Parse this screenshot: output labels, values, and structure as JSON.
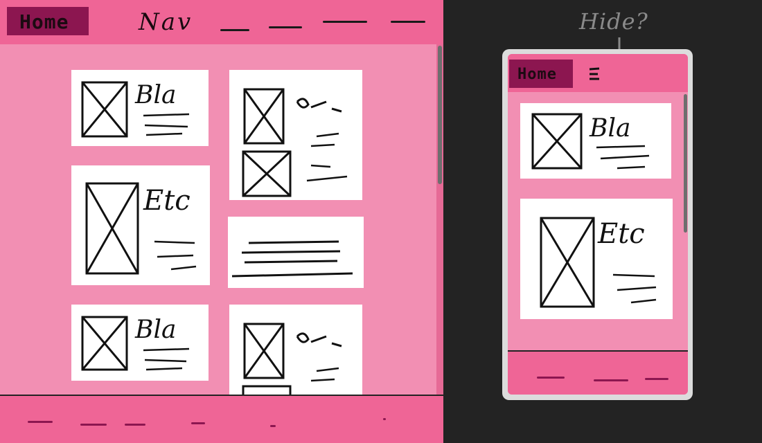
{
  "desktop": {
    "nav": {
      "home_label": "Home",
      "nav_label": "Nav"
    },
    "cards": [
      {
        "heading": "Bla"
      },
      {
        "heading": "Etc"
      },
      {
        "heading": "Bla"
      },
      {
        "heading": ""
      },
      {
        "heading": ""
      }
    ]
  },
  "mobile": {
    "nav": {
      "home_label": "Home",
      "menu_icon": "hamburger-menu-icon"
    },
    "cards": [
      {
        "heading": "Bla"
      },
      {
        "heading": "Etc"
      }
    ]
  },
  "annotation": {
    "hide_note": "Hide?"
  },
  "colors": {
    "nav_bar": "#ef6596",
    "page_bg": "#f28fb3",
    "home_badge": "#8c1650",
    "canvas_bg": "#232323",
    "card_bg": "#ffffff",
    "annotation_text": "#8a8a8a"
  }
}
